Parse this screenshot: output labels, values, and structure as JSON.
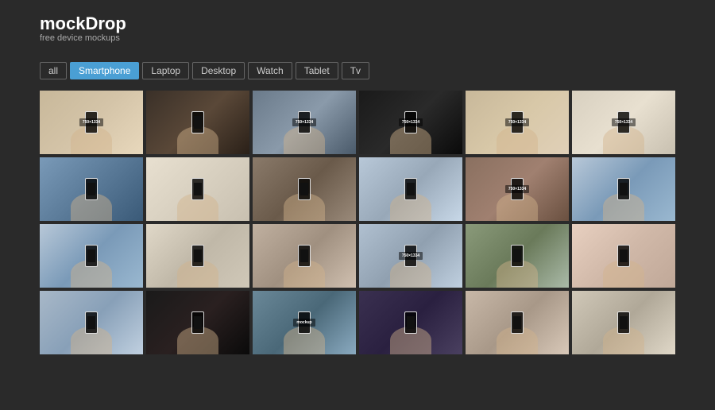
{
  "header": {
    "logo": "mockDrop",
    "tagline": "free device mockups"
  },
  "filters": {
    "buttons": [
      {
        "id": "all",
        "label": "all",
        "active": false
      },
      {
        "id": "smartphone",
        "label": "Smartphone",
        "active": true
      },
      {
        "id": "laptop",
        "label": "Laptop",
        "active": false
      },
      {
        "id": "desktop",
        "label": "Desktop",
        "active": false
      },
      {
        "id": "watch",
        "label": "Watch",
        "active": false
      },
      {
        "id": "tablet",
        "label": "Tablet",
        "active": false
      },
      {
        "id": "tv",
        "label": "Tv",
        "active": false
      }
    ]
  },
  "gallery": {
    "items": [
      {
        "id": 1,
        "label": "750x1334",
        "bg": "bg1"
      },
      {
        "id": 2,
        "label": "",
        "bg": "bg2"
      },
      {
        "id": 3,
        "label": "",
        "bg": "bg3"
      },
      {
        "id": 4,
        "label": "750x1334",
        "bg": "bg4"
      },
      {
        "id": 5,
        "label": "750x1334",
        "bg": "bg5"
      },
      {
        "id": 6,
        "label": "750x1334",
        "bg": "bg6"
      },
      {
        "id": 7,
        "label": "",
        "bg": "bg7"
      },
      {
        "id": 8,
        "label": "",
        "bg": "bg8"
      },
      {
        "id": 9,
        "label": "",
        "bg": "bg9"
      },
      {
        "id": 10,
        "label": "",
        "bg": "bg10"
      },
      {
        "id": 11,
        "label": "750x1334",
        "bg": "bg11"
      },
      {
        "id": 12,
        "label": "",
        "bg": "bg12"
      },
      {
        "id": 13,
        "label": "",
        "bg": "bg12"
      },
      {
        "id": 14,
        "label": "",
        "bg": "bg13"
      },
      {
        "id": 15,
        "label": "",
        "bg": "bg14"
      },
      {
        "id": 16,
        "label": "750x1334",
        "bg": "bg15"
      },
      {
        "id": 17,
        "label": "",
        "bg": "bg16"
      },
      {
        "id": 18,
        "label": "",
        "bg": "bg17"
      },
      {
        "id": 19,
        "label": "",
        "bg": "bg18"
      },
      {
        "id": 20,
        "label": "",
        "bg": "bg19"
      },
      {
        "id": 21,
        "label": "",
        "bg": "bg20"
      },
      {
        "id": 22,
        "label": "",
        "bg": "bg21"
      },
      {
        "id": 23,
        "label": "",
        "bg": "bg22"
      },
      {
        "id": 24,
        "label": "",
        "bg": "bg23"
      }
    ]
  }
}
